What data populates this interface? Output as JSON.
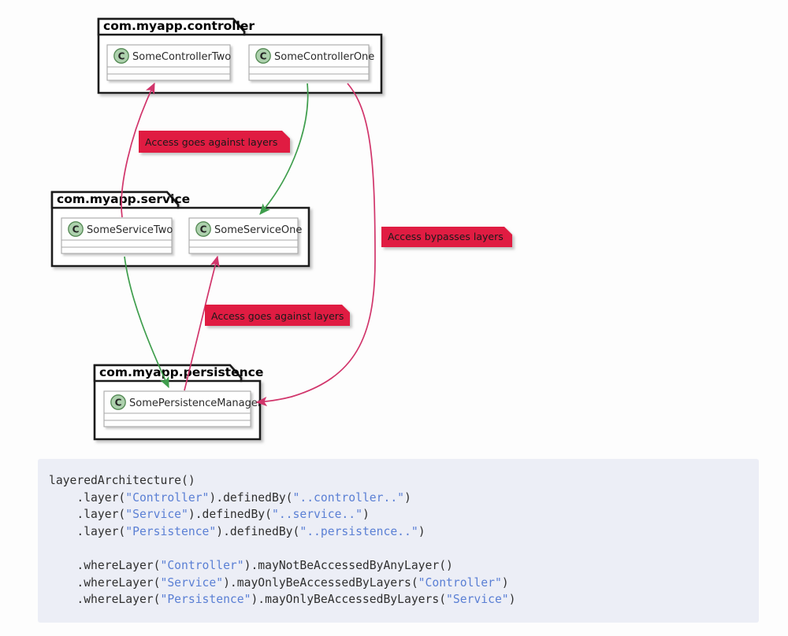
{
  "diagram": {
    "type": "uml-package-class-diagram",
    "background_color": "#fdfdfd",
    "packages": [
      {
        "id": "controller",
        "name": "com.myapp.controller",
        "classes": [
          {
            "id": "some-controller-two",
            "name": "SomeControllerTwo",
            "stereotype": "C"
          },
          {
            "id": "some-controller-one",
            "name": "SomeControllerOne",
            "stereotype": "C"
          }
        ]
      },
      {
        "id": "service",
        "name": "com.myapp.service",
        "classes": [
          {
            "id": "some-service-two",
            "name": "SomeServiceTwo",
            "stereotype": "C"
          },
          {
            "id": "some-service-one",
            "name": "SomeServiceOne",
            "stereotype": "C"
          }
        ]
      },
      {
        "id": "persistence",
        "name": "com.myapp.persistence",
        "classes": [
          {
            "id": "some-persistence-manager",
            "name": "SomePersistenceManager",
            "stereotype": "C"
          }
        ]
      }
    ],
    "notes": [
      {
        "id": "note-1",
        "text": "Access goes against layers",
        "color": "#e01b43"
      },
      {
        "id": "note-2",
        "text": "Access bypasses layers",
        "color": "#e01b43"
      },
      {
        "id": "note-3",
        "text": "Access goes against layers",
        "color": "#e01b43"
      }
    ],
    "edges": [
      {
        "id": "edge-service-two-to-controller-two",
        "from": "SomeServiceTwo",
        "to": "SomeControllerTwo",
        "color": "#d1356b",
        "kind": "violation"
      },
      {
        "id": "edge-controller-one-to-service-one",
        "from": "SomeControllerOne",
        "to": "SomeServiceOne",
        "color": "#3f9e4d",
        "kind": "allowed"
      },
      {
        "id": "edge-controller-one-to-persistence",
        "from": "SomeControllerOne",
        "to": "SomePersistenceManager",
        "color": "#d1356b",
        "kind": "violation"
      },
      {
        "id": "edge-service-two-to-persistence",
        "from": "SomeServiceTwo",
        "to": "SomePersistenceManager",
        "color": "#3f9e4d",
        "kind": "allowed"
      },
      {
        "id": "edge-persistence-to-service-one",
        "from": "SomePersistenceManager",
        "to": "SomeServiceOne",
        "color": "#d1356b",
        "kind": "violation"
      }
    ],
    "colors": {
      "violation": "#d1356b",
      "allowed": "#3f9e4d",
      "note_fill": "#e01b43",
      "class_icon_fill": "#add1ad",
      "class_icon_stroke": "#538853",
      "box_fill": "#fefefe",
      "box_stroke": "#a0a0a0",
      "package_stroke": "#1b1b1b"
    }
  },
  "code": {
    "background_color": "#eceef6",
    "string_color": "#5a7fd4",
    "text_color": "#2f2f2f",
    "lines": [
      [
        {
          "t": "layeredArchitecture()",
          "s": false
        }
      ],
      [
        {
          "t": "    .layer(",
          "s": false
        },
        {
          "t": "\"Controller\"",
          "s": true
        },
        {
          "t": ").definedBy(",
          "s": false
        },
        {
          "t": "\"..controller..\"",
          "s": true
        },
        {
          "t": ")",
          "s": false
        }
      ],
      [
        {
          "t": "    .layer(",
          "s": false
        },
        {
          "t": "\"Service\"",
          "s": true
        },
        {
          "t": ").definedBy(",
          "s": false
        },
        {
          "t": "\"..service..\"",
          "s": true
        },
        {
          "t": ")",
          "s": false
        }
      ],
      [
        {
          "t": "    .layer(",
          "s": false
        },
        {
          "t": "\"Persistence\"",
          "s": true
        },
        {
          "t": ").definedBy(",
          "s": false
        },
        {
          "t": "\"..persistence..\"",
          "s": true
        },
        {
          "t": ")",
          "s": false
        }
      ],
      [
        {
          "t": "",
          "s": false
        }
      ],
      [
        {
          "t": "    .whereLayer(",
          "s": false
        },
        {
          "t": "\"Controller\"",
          "s": true
        },
        {
          "t": ").mayNotBeAccessedByAnyLayer()",
          "s": false
        }
      ],
      [
        {
          "t": "    .whereLayer(",
          "s": false
        },
        {
          "t": "\"Service\"",
          "s": true
        },
        {
          "t": ").mayOnlyBeAccessedByLayers(",
          "s": false
        },
        {
          "t": "\"Controller\"",
          "s": true
        },
        {
          "t": ")",
          "s": false
        }
      ],
      [
        {
          "t": "    .whereLayer(",
          "s": false
        },
        {
          "t": "\"Persistence\"",
          "s": true
        },
        {
          "t": ").mayOnlyBeAccessedByLayers(",
          "s": false
        },
        {
          "t": "\"Service\"",
          "s": true
        },
        {
          "t": ")",
          "s": false
        }
      ]
    ]
  }
}
